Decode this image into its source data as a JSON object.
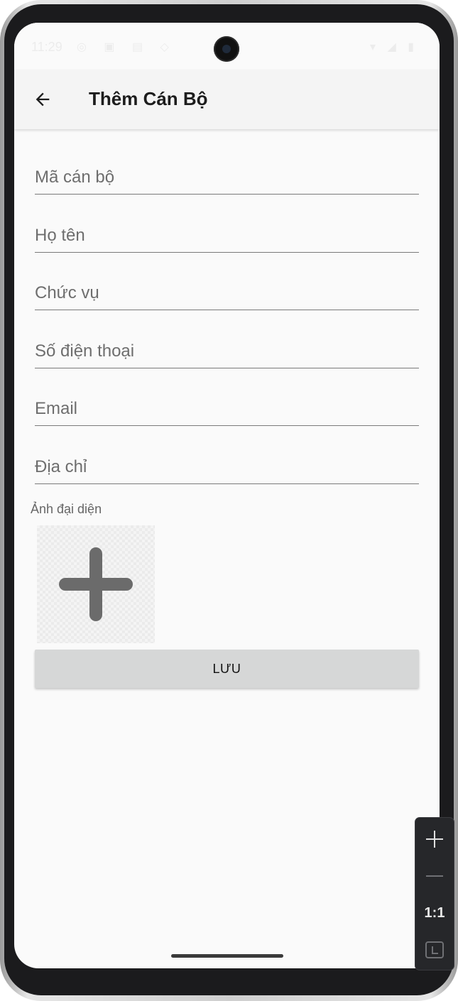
{
  "status_bar": {
    "time": "11:29",
    "left_icons": "◎ ▣ ▤ ◇",
    "right_icons": "▾ ◢ ▮"
  },
  "app_bar": {
    "back_icon": "arrow-back",
    "title": "Thêm Cán Bộ"
  },
  "form": {
    "fields": [
      {
        "placeholder": "Mã cán bộ",
        "value": ""
      },
      {
        "placeholder": "Họ tên",
        "value": ""
      },
      {
        "placeholder": "Chức vụ",
        "value": ""
      },
      {
        "placeholder": "Số điện thoại",
        "value": ""
      },
      {
        "placeholder": "Email",
        "value": ""
      },
      {
        "placeholder": "Địa chỉ",
        "value": ""
      }
    ],
    "avatar_label": "Ảnh đại diện",
    "avatar_icon": "plus-icon",
    "save_label": "LƯU"
  },
  "zoom_controls": {
    "zoom_in_icon": "plus",
    "zoom_out_icon": "minus",
    "ratio_label": "1:1",
    "fit_icon": "fit-screen"
  },
  "colors": {
    "screen_bg": "#fafafa",
    "app_bar_bg": "#f4f4f4",
    "button_bg": "#d6d7d7",
    "icon_gray": "#6b6b6b"
  }
}
